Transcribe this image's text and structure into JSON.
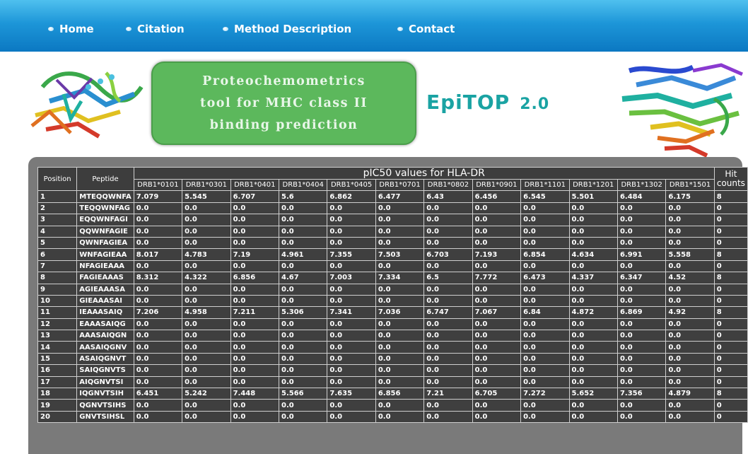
{
  "nav": {
    "items": [
      {
        "label": "Home"
      },
      {
        "label": "Citation"
      },
      {
        "label": "Method Description"
      },
      {
        "label": "Contact"
      }
    ]
  },
  "header": {
    "title_lines": [
      "Proteochemometrics",
      "tool for MHC class II",
      "binding prediction"
    ],
    "logo_name": "EpiTOP",
    "logo_version": "2.0"
  },
  "colors": {
    "nav_blue": "#1d96d8",
    "title_green": "#5cb85c",
    "logo_teal": "#1aa3a3",
    "table_bg": "#3f3f3f",
    "frame_gray": "#7a7a7a"
  },
  "table": {
    "col_position": "Position",
    "col_peptide": "Peptide",
    "group_header": "pIC50 values for HLA-DR",
    "col_hit": "Hit counts",
    "alleles": [
      "DRB1*0101",
      "DRB1*0301",
      "DRB1*0401",
      "DRB1*0404",
      "DRB1*0405",
      "DRB1*0701",
      "DRB1*0802",
      "DRB1*0901",
      "DRB1*1101",
      "DRB1*1201",
      "DRB1*1302",
      "DRB1*1501"
    ],
    "rows": [
      {
        "pos": "1",
        "pep": "MTEQQWNFA",
        "vals": [
          "7.079",
          "5.545",
          "6.707",
          "5.6",
          "6.862",
          "6.477",
          "6.43",
          "6.456",
          "6.545",
          "5.501",
          "6.484",
          "6.175"
        ],
        "hit": "8"
      },
      {
        "pos": "2",
        "pep": "TEQQWNFAG",
        "vals": [
          "0.0",
          "0.0",
          "0.0",
          "0.0",
          "0.0",
          "0.0",
          "0.0",
          "0.0",
          "0.0",
          "0.0",
          "0.0",
          "0.0"
        ],
        "hit": "0"
      },
      {
        "pos": "3",
        "pep": "EQQWNFAGI",
        "vals": [
          "0.0",
          "0.0",
          "0.0",
          "0.0",
          "0.0",
          "0.0",
          "0.0",
          "0.0",
          "0.0",
          "0.0",
          "0.0",
          "0.0"
        ],
        "hit": "0"
      },
      {
        "pos": "4",
        "pep": "QQWNFAGIE",
        "vals": [
          "0.0",
          "0.0",
          "0.0",
          "0.0",
          "0.0",
          "0.0",
          "0.0",
          "0.0",
          "0.0",
          "0.0",
          "0.0",
          "0.0"
        ],
        "hit": "0"
      },
      {
        "pos": "5",
        "pep": "QWNFAGIEA",
        "vals": [
          "0.0",
          "0.0",
          "0.0",
          "0.0",
          "0.0",
          "0.0",
          "0.0",
          "0.0",
          "0.0",
          "0.0",
          "0.0",
          "0.0"
        ],
        "hit": "0"
      },
      {
        "pos": "6",
        "pep": "WNFAGIEAA",
        "vals": [
          "8.017",
          "4.783",
          "7.19",
          "4.961",
          "7.355",
          "7.503",
          "6.703",
          "7.193",
          "6.854",
          "4.634",
          "6.991",
          "5.558"
        ],
        "hit": "8"
      },
      {
        "pos": "7",
        "pep": "NFAGIEAAA",
        "vals": [
          "0.0",
          "0.0",
          "0.0",
          "0.0",
          "0.0",
          "0.0",
          "0.0",
          "0.0",
          "0.0",
          "0.0",
          "0.0",
          "0.0"
        ],
        "hit": "0"
      },
      {
        "pos": "8",
        "pep": "FAGIEAAAS",
        "vals": [
          "8.312",
          "4.322",
          "6.856",
          "4.67",
          "7.003",
          "7.334",
          "6.5",
          "7.772",
          "6.473",
          "4.337",
          "6.347",
          "4.52"
        ],
        "hit": "8"
      },
      {
        "pos": "9",
        "pep": "AGIEAAASA",
        "vals": [
          "0.0",
          "0.0",
          "0.0",
          "0.0",
          "0.0",
          "0.0",
          "0.0",
          "0.0",
          "0.0",
          "0.0",
          "0.0",
          "0.0"
        ],
        "hit": "0"
      },
      {
        "pos": "10",
        "pep": "GIEAAASAI",
        "vals": [
          "0.0",
          "0.0",
          "0.0",
          "0.0",
          "0.0",
          "0.0",
          "0.0",
          "0.0",
          "0.0",
          "0.0",
          "0.0",
          "0.0"
        ],
        "hit": "0"
      },
      {
        "pos": "11",
        "pep": "IEAAASAIQ",
        "vals": [
          "7.206",
          "4.958",
          "7.211",
          "5.306",
          "7.341",
          "7.036",
          "6.747",
          "7.067",
          "6.84",
          "4.872",
          "6.869",
          "4.92"
        ],
        "hit": "8"
      },
      {
        "pos": "12",
        "pep": "EAAASAIQG",
        "vals": [
          "0.0",
          "0.0",
          "0.0",
          "0.0",
          "0.0",
          "0.0",
          "0.0",
          "0.0",
          "0.0",
          "0.0",
          "0.0",
          "0.0"
        ],
        "hit": "0"
      },
      {
        "pos": "13",
        "pep": "AAASAIQGN",
        "vals": [
          "0.0",
          "0.0",
          "0.0",
          "0.0",
          "0.0",
          "0.0",
          "0.0",
          "0.0",
          "0.0",
          "0.0",
          "0.0",
          "0.0"
        ],
        "hit": "0"
      },
      {
        "pos": "14",
        "pep": "AASAIQGNV",
        "vals": [
          "0.0",
          "0.0",
          "0.0",
          "0.0",
          "0.0",
          "0.0",
          "0.0",
          "0.0",
          "0.0",
          "0.0",
          "0.0",
          "0.0"
        ],
        "hit": "0"
      },
      {
        "pos": "15",
        "pep": "ASAIQGNVT",
        "vals": [
          "0.0",
          "0.0",
          "0.0",
          "0.0",
          "0.0",
          "0.0",
          "0.0",
          "0.0",
          "0.0",
          "0.0",
          "0.0",
          "0.0"
        ],
        "hit": "0"
      },
      {
        "pos": "16",
        "pep": "SAIQGNVTS",
        "vals": [
          "0.0",
          "0.0",
          "0.0",
          "0.0",
          "0.0",
          "0.0",
          "0.0",
          "0.0",
          "0.0",
          "0.0",
          "0.0",
          "0.0"
        ],
        "hit": "0"
      },
      {
        "pos": "17",
        "pep": "AIQGNVTSI",
        "vals": [
          "0.0",
          "0.0",
          "0.0",
          "0.0",
          "0.0",
          "0.0",
          "0.0",
          "0.0",
          "0.0",
          "0.0",
          "0.0",
          "0.0"
        ],
        "hit": "0"
      },
      {
        "pos": "18",
        "pep": "IQGNVTSIH",
        "vals": [
          "6.451",
          "5.242",
          "7.448",
          "5.566",
          "7.635",
          "6.856",
          "7.21",
          "6.705",
          "7.272",
          "5.652",
          "7.356",
          "4.879"
        ],
        "hit": "8"
      },
      {
        "pos": "19",
        "pep": "QGNVTSIHS",
        "vals": [
          "0.0",
          "0.0",
          "0.0",
          "0.0",
          "0.0",
          "0.0",
          "0.0",
          "0.0",
          "0.0",
          "0.0",
          "0.0",
          "0.0"
        ],
        "hit": "0"
      },
      {
        "pos": "20",
        "pep": "GNVTSIHSL",
        "vals": [
          "0.0",
          "0.0",
          "0.0",
          "0.0",
          "0.0",
          "0.0",
          "0.0",
          "0.0",
          "0.0",
          "0.0",
          "0.0",
          "0.0"
        ],
        "hit": "0"
      }
    ]
  }
}
